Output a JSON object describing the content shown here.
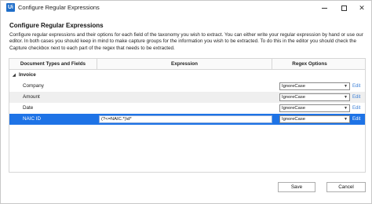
{
  "window": {
    "title": "Configure Regular Expressions",
    "app_icon": "Ui"
  },
  "heading": "Configure Regular Expressions",
  "description": "Configure regular expressions and their options for each field of the taxonomy you wish to extract. You can either write your regular expression by hand or use our editor. In both cases you should keep in mind to make capture groups for the information you wish to be extracted. To do this in the editor you should check the Capture checkbox next to each part of the regex that needs to be extracted.",
  "grid": {
    "columns": [
      "Document Types and Fields",
      "Expression",
      "Regex Options"
    ],
    "group": "Invoice",
    "rows": [
      {
        "field": "Company",
        "expression": "",
        "option": "IgnoreCase",
        "edit": "Edit",
        "selected": false
      },
      {
        "field": "Amount",
        "expression": "",
        "option": "IgnoreCase",
        "edit": "Edit",
        "selected": false
      },
      {
        "field": "Date",
        "expression": "",
        "option": "IgnoreCase",
        "edit": "Edit",
        "selected": false
      },
      {
        "field": "NAIC ID",
        "expression": "(?<=NAIC.*)\\d*",
        "option": "IgnoreCase",
        "edit": "Edit",
        "selected": true
      }
    ]
  },
  "buttons": {
    "save": "Save",
    "cancel": "Cancel"
  },
  "colors": {
    "selection": "#1e73e6",
    "link": "#3b7fd6",
    "accent": "#1f6ec9"
  }
}
